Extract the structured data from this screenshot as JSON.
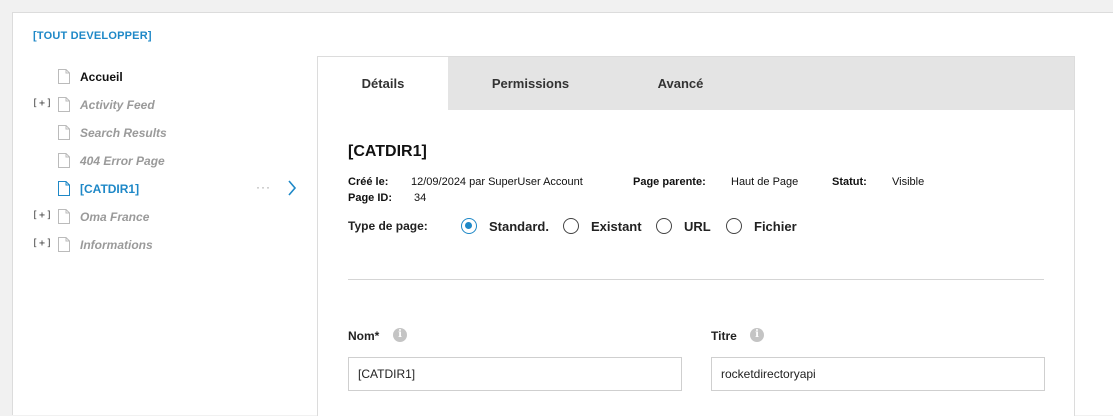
{
  "expand_all_label": "[TOUT DEVELOPPER]",
  "tree": [
    {
      "toggle": "",
      "label": "Accueil",
      "style": "normal"
    },
    {
      "toggle": "[+]",
      "label": "Activity Feed",
      "style": "muted"
    },
    {
      "toggle": "",
      "label": "Search Results",
      "style": "muted"
    },
    {
      "toggle": "",
      "label": "404 Error Page",
      "style": "muted"
    },
    {
      "toggle": "",
      "label": "[CATDIR1]",
      "style": "active",
      "more": "···"
    },
    {
      "toggle": "[+]",
      "label": "Oma France",
      "style": "muted"
    },
    {
      "toggle": "[+]",
      "label": "Informations",
      "style": "muted"
    }
  ],
  "tabs": [
    {
      "label": "Détails",
      "active": true
    },
    {
      "label": "Permissions",
      "active": false
    },
    {
      "label": "Avancé",
      "active": false
    }
  ],
  "page": {
    "title": "[CATDIR1]",
    "created_label": "Créé le:",
    "created_value": "12/09/2024 par SuperUser Account",
    "parent_label": "Page parente:",
    "parent_value": "Haut de Page",
    "status_label": "Statut:",
    "status_value": "Visible",
    "pageid_label": "Page ID:",
    "pageid_value": "34",
    "type_label": "Type de page:",
    "type_options": [
      {
        "label": "Standard.",
        "checked": true
      },
      {
        "label": "Existant",
        "checked": false
      },
      {
        "label": "URL",
        "checked": false
      },
      {
        "label": "Fichier",
        "checked": false
      }
    ]
  },
  "form": {
    "name_label": "Nom*",
    "name_value": "[CATDIR1]",
    "title_label": "Titre",
    "title_value": "rocketdirectoryapi",
    "info_glyph": "i"
  },
  "colors": {
    "accent": "#1e88c7",
    "muted": "#9a9a9a",
    "tab_bar": "#e4e4e4"
  }
}
